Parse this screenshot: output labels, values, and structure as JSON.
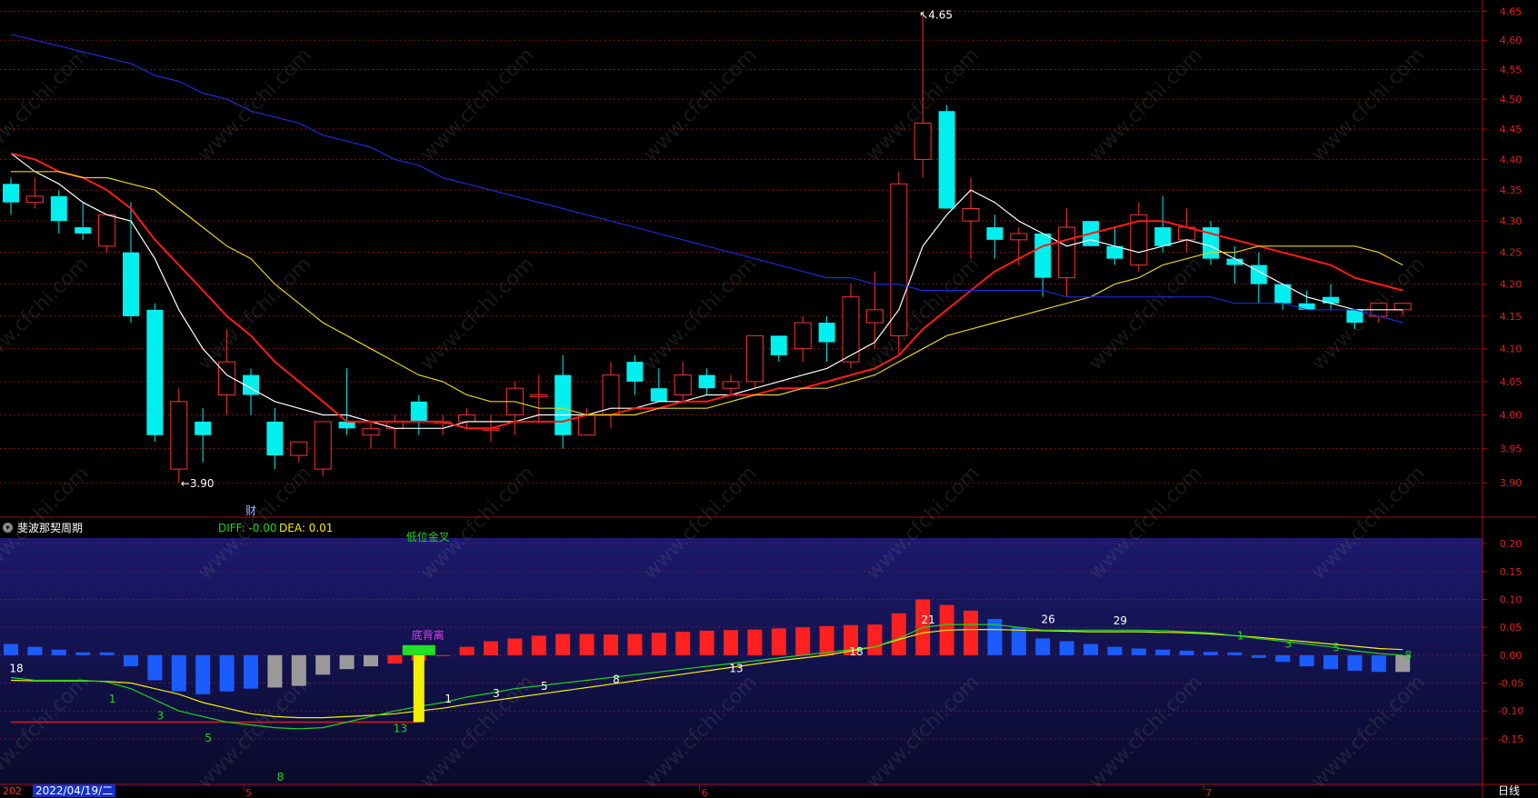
{
  "chart_data": [
    {
      "type": "candlestick",
      "scale": "log",
      "y_ticks": [
        "4.65",
        "4.60",
        "4.55",
        "4.50",
        "4.45",
        "4.40",
        "4.35",
        "4.30",
        "4.25",
        "4.20",
        "4.15",
        "4.10",
        "4.05",
        "4.00",
        "3.95",
        "3.90"
      ],
      "ylim": [
        3.87,
        4.66
      ],
      "ohlc": [
        [
          4.36,
          4.37,
          4.31,
          4.33
        ],
        [
          4.33,
          4.37,
          4.32,
          4.34
        ],
        [
          4.34,
          4.35,
          4.28,
          4.3
        ],
        [
          4.29,
          4.33,
          4.27,
          4.28
        ],
        [
          4.26,
          4.31,
          4.25,
          4.31
        ],
        [
          4.25,
          4.33,
          4.14,
          4.15
        ],
        [
          4.16,
          4.17,
          3.96,
          3.97
        ],
        [
          3.92,
          4.04,
          3.9,
          4.02
        ],
        [
          3.99,
          4.01,
          3.93,
          3.97
        ],
        [
          4.03,
          4.13,
          4.0,
          4.08
        ],
        [
          4.06,
          4.07,
          4.0,
          4.03
        ],
        [
          3.99,
          4.01,
          3.92,
          3.94
        ],
        [
          3.94,
          3.96,
          3.93,
          3.96
        ],
        [
          3.92,
          3.99,
          3.91,
          3.99
        ],
        [
          3.99,
          4.07,
          3.97,
          3.98
        ],
        [
          3.97,
          3.99,
          3.95,
          3.98
        ],
        [
          3.98,
          4.0,
          3.95,
          3.99
        ],
        [
          4.02,
          4.03,
          3.97,
          3.99
        ],
        [
          3.99,
          4.0,
          3.97,
          3.99
        ],
        [
          3.99,
          4.01,
          3.98,
          4.0
        ],
        [
          3.98,
          4.0,
          3.96,
          3.98
        ],
        [
          4.0,
          4.05,
          3.97,
          4.04
        ],
        [
          4.03,
          4.06,
          3.99,
          4.03
        ],
        [
          4.06,
          4.09,
          3.95,
          3.97
        ],
        [
          3.97,
          4.01,
          3.97,
          4.0
        ],
        [
          4.0,
          4.08,
          3.98,
          4.06
        ],
        [
          4.08,
          4.09,
          4.03,
          4.05
        ],
        [
          4.04,
          4.07,
          4.02,
          4.02
        ],
        [
          4.03,
          4.08,
          4.02,
          4.06
        ],
        [
          4.06,
          4.07,
          4.03,
          4.04
        ],
        [
          4.04,
          4.06,
          4.03,
          4.05
        ],
        [
          4.05,
          4.12,
          4.04,
          4.12
        ],
        [
          4.12,
          4.12,
          4.08,
          4.09
        ],
        [
          4.1,
          4.15,
          4.08,
          4.14
        ],
        [
          4.14,
          4.15,
          4.08,
          4.11
        ],
        [
          4.08,
          4.2,
          4.07,
          4.18
        ],
        [
          4.14,
          4.22,
          4.1,
          4.16
        ],
        [
          4.12,
          4.38,
          4.09,
          4.36
        ],
        [
          4.4,
          4.65,
          4.37,
          4.46
        ],
        [
          4.48,
          4.49,
          4.32,
          4.32
        ],
        [
          4.3,
          4.37,
          4.24,
          4.32
        ],
        [
          4.29,
          4.31,
          4.24,
          4.27
        ],
        [
          4.27,
          4.29,
          4.23,
          4.28
        ],
        [
          4.28,
          4.28,
          4.18,
          4.21
        ],
        [
          4.21,
          4.32,
          4.18,
          4.29
        ],
        [
          4.3,
          4.3,
          4.26,
          4.26
        ],
        [
          4.26,
          4.29,
          4.23,
          4.24
        ],
        [
          4.23,
          4.33,
          4.22,
          4.31
        ],
        [
          4.29,
          4.34,
          4.25,
          4.26
        ],
        [
          4.27,
          4.32,
          4.25,
          4.29
        ],
        [
          4.29,
          4.3,
          4.23,
          4.24
        ],
        [
          4.24,
          4.26,
          4.2,
          4.23
        ],
        [
          4.23,
          4.25,
          4.17,
          4.2
        ],
        [
          4.2,
          4.2,
          4.16,
          4.17
        ],
        [
          4.17,
          4.19,
          4.16,
          4.16
        ],
        [
          4.18,
          4.2,
          4.16,
          4.17
        ],
        [
          4.16,
          4.16,
          4.13,
          4.14
        ],
        [
          4.15,
          4.17,
          4.14,
          4.17
        ],
        [
          4.16,
          4.17,
          4.15,
          4.17
        ]
      ],
      "ma": [
        {
          "color": "#ffffff",
          "values": [
            4.41,
            4.38,
            4.36,
            4.33,
            4.31,
            4.3,
            4.24,
            4.16,
            4.1,
            4.06,
            4.04,
            4.02,
            4.01,
            4.0,
            4.0,
            3.99,
            3.98,
            3.98,
            3.98,
            3.99,
            3.99,
            3.99,
            4.0,
            4.0,
            4.0,
            4.01,
            4.01,
            4.02,
            4.02,
            4.03,
            4.03,
            4.04,
            4.05,
            4.06,
            4.07,
            4.09,
            4.11,
            4.16,
            4.26,
            4.31,
            4.35,
            4.33,
            4.3,
            4.28,
            4.26,
            4.27,
            4.26,
            4.25,
            4.26,
            4.27,
            4.26,
            4.24,
            4.22,
            4.2,
            4.18,
            4.17,
            4.16,
            4.16,
            4.16
          ]
        },
        {
          "color": "#ff1a1a",
          "values": [
            4.41,
            4.4,
            4.38,
            4.37,
            4.35,
            4.32,
            4.27,
            4.23,
            4.19,
            4.15,
            4.12,
            4.08,
            4.05,
            4.02,
            3.99,
            3.99,
            3.99,
            3.99,
            3.99,
            3.98,
            3.98,
            3.99,
            3.99,
            3.99,
            4.0,
            4.0,
            4.01,
            4.01,
            4.02,
            4.02,
            4.03,
            4.03,
            4.04,
            4.04,
            4.05,
            4.06,
            4.07,
            4.09,
            4.13,
            4.16,
            4.19,
            4.22,
            4.24,
            4.26,
            4.27,
            4.28,
            4.29,
            4.3,
            4.3,
            4.29,
            4.28,
            4.27,
            4.26,
            4.25,
            4.24,
            4.23,
            4.21,
            4.2,
            4.19
          ]
        },
        {
          "color": "#e6d41a",
          "values": [
            4.38,
            4.38,
            4.38,
            4.37,
            4.37,
            4.36,
            4.35,
            4.32,
            4.29,
            4.26,
            4.24,
            4.2,
            4.17,
            4.14,
            4.12,
            4.1,
            4.08,
            4.06,
            4.05,
            4.03,
            4.02,
            4.02,
            4.01,
            4.01,
            4.0,
            4.0,
            4.0,
            4.01,
            4.01,
            4.01,
            4.02,
            4.03,
            4.03,
            4.04,
            4.04,
            4.05,
            4.06,
            4.08,
            4.1,
            4.12,
            4.13,
            4.14,
            4.15,
            4.16,
            4.17,
            4.18,
            4.2,
            4.21,
            4.23,
            4.24,
            4.25,
            4.25,
            4.26,
            4.26,
            4.26,
            4.26,
            4.26,
            4.25,
            4.23
          ]
        },
        {
          "color": "#1c2cd6",
          "values": [
            4.61,
            4.6,
            4.59,
            4.58,
            4.57,
            4.56,
            4.54,
            4.53,
            4.51,
            4.5,
            4.48,
            4.47,
            4.46,
            4.44,
            4.43,
            4.42,
            4.4,
            4.39,
            4.37,
            4.36,
            4.35,
            4.34,
            4.33,
            4.32,
            4.31,
            4.3,
            4.29,
            4.28,
            4.27,
            4.26,
            4.25,
            4.24,
            4.23,
            4.22,
            4.21,
            4.21,
            4.2,
            4.2,
            4.19,
            4.19,
            4.19,
            4.19,
            4.19,
            4.19,
            4.18,
            4.18,
            4.18,
            4.18,
            4.18,
            4.18,
            4.18,
            4.17,
            4.17,
            4.17,
            4.16,
            4.16,
            4.16,
            4.15,
            4.14
          ]
        }
      ],
      "annotations": [
        {
          "text": "4.65",
          "bar": 38,
          "at": "high"
        },
        {
          "text": "3.90",
          "bar": 7,
          "at": "low"
        },
        {
          "text": "财",
          "bar": 10,
          "at": "below"
        }
      ]
    },
    {
      "type": "macd",
      "title": "斐波那契周期",
      "diff_label": "DIFF: -0.00",
      "dea_label": "DEA: 0.01",
      "y_ticks": [
        "0.20",
        "0.15",
        "0.10",
        "0.05",
        "0.00",
        "-0.05",
        "-0.10",
        "-0.15"
      ],
      "ylim": [
        -0.23,
        0.21
      ],
      "macd": [
        0.02,
        0.015,
        0.01,
        0.005,
        0.005,
        -0.02,
        -0.045,
        -0.065,
        -0.07,
        -0.065,
        -0.06,
        -0.058,
        -0.055,
        -0.035,
        -0.025,
        -0.02,
        -0.015,
        -0.01,
        0.0,
        0.015,
        0.025,
        0.03,
        0.035,
        0.038,
        0.038,
        0.037,
        0.038,
        0.04,
        0.042,
        0.044,
        0.045,
        0.046,
        0.048,
        0.05,
        0.052,
        0.054,
        0.055,
        0.075,
        0.1,
        0.09,
        0.08,
        0.065,
        0.05,
        0.03,
        0.025,
        0.02,
        0.015,
        0.012,
        0.01,
        0.008,
        0.006,
        0.005,
        -0.005,
        -0.012,
        -0.02,
        -0.025,
        -0.028,
        -0.03,
        -0.03
      ],
      "macd_colors": [
        "b",
        "b",
        "b",
        "b",
        "b",
        "b",
        "b",
        "b",
        "b",
        "b",
        "b",
        "g",
        "g",
        "g",
        "g",
        "g",
        "r",
        "r",
        "r",
        "r",
        "r",
        "r",
        "r",
        "r",
        "r",
        "r",
        "r",
        "r",
        "r",
        "r",
        "r",
        "r",
        "r",
        "r",
        "r",
        "r",
        "r",
        "r",
        "r",
        "r",
        "r",
        "b",
        "b",
        "b",
        "b",
        "b",
        "b",
        "b",
        "b",
        "b",
        "b",
        "b",
        "b",
        "b",
        "b",
        "b",
        "b",
        "b",
        "g"
      ],
      "diff_line": [
        -0.04,
        -0.045,
        -0.045,
        -0.045,
        -0.048,
        -0.06,
        -0.08,
        -0.1,
        -0.11,
        -0.12,
        -0.125,
        -0.13,
        -0.132,
        -0.13,
        -0.12,
        -0.11,
        -0.1,
        -0.092,
        -0.085,
        -0.075,
        -0.068,
        -0.06,
        -0.055,
        -0.05,
        -0.045,
        -0.04,
        -0.035,
        -0.03,
        -0.025,
        -0.02,
        -0.015,
        -0.01,
        -0.005,
        0.0,
        0.005,
        0.01,
        0.015,
        0.03,
        0.05,
        0.055,
        0.055,
        0.055,
        0.05,
        0.045,
        0.045,
        0.045,
        0.045,
        0.045,
        0.044,
        0.042,
        0.04,
        0.035,
        0.03,
        0.025,
        0.02,
        0.015,
        0.008,
        0.003,
        0.0
      ],
      "dea_line": [
        -0.045,
        -0.046,
        -0.046,
        -0.046,
        -0.047,
        -0.05,
        -0.06,
        -0.07,
        -0.085,
        -0.095,
        -0.105,
        -0.11,
        -0.112,
        -0.112,
        -0.11,
        -0.108,
        -0.105,
        -0.1,
        -0.095,
        -0.088,
        -0.082,
        -0.076,
        -0.07,
        -0.064,
        -0.058,
        -0.052,
        -0.046,
        -0.04,
        -0.034,
        -0.028,
        -0.022,
        -0.016,
        -0.01,
        -0.005,
        0.0,
        0.008,
        0.015,
        0.028,
        0.04,
        0.045,
        0.046,
        0.046,
        0.045,
        0.044,
        0.043,
        0.042,
        0.042,
        0.042,
        0.041,
        0.04,
        0.038,
        0.035,
        0.032,
        0.028,
        0.024,
        0.02,
        0.016,
        0.012,
        0.01
      ],
      "signal_line_value": -0.12,
      "labels": [
        {
          "text": "18",
          "bar": 0,
          "value": -0.03,
          "color": "#ffffff"
        },
        {
          "text": "1",
          "bar": 4,
          "value": -0.085,
          "color": "#1fd41f"
        },
        {
          "text": "3",
          "bar": 6,
          "value": -0.115,
          "color": "#1fd41f"
        },
        {
          "text": "5",
          "bar": 8,
          "value": -0.155,
          "color": "#1fd41f"
        },
        {
          "text": "8",
          "bar": 11,
          "value": -0.225,
          "color": "#1fd41f"
        },
        {
          "text": "13",
          "bar": 16,
          "value": -0.138,
          "color": "#1fd41f"
        },
        {
          "text": "1",
          "bar": 18,
          "value": -0.085,
          "color": "#ffffff"
        },
        {
          "text": "3",
          "bar": 20,
          "value": -0.075,
          "color": "#ffffff"
        },
        {
          "text": "5",
          "bar": 22,
          "value": -0.062,
          "color": "#ffffff"
        },
        {
          "text": "8",
          "bar": 25,
          "value": -0.05,
          "color": "#ffffff"
        },
        {
          "text": "13",
          "bar": 30,
          "value": -0.03,
          "color": "#ffffff"
        },
        {
          "text": "18",
          "bar": 35,
          "value": 0.0,
          "color": "#ffffff"
        },
        {
          "text": "21",
          "bar": 38,
          "value": 0.057,
          "color": "#ffffff"
        },
        {
          "text": "26",
          "bar": 43,
          "value": 0.058,
          "color": "#ffffff"
        },
        {
          "text": "29",
          "bar": 46,
          "value": 0.055,
          "color": "#ffffff"
        },
        {
          "text": "1",
          "bar": 51,
          "value": 0.028,
          "color": "#1fd41f"
        },
        {
          "text": "3",
          "bar": 53,
          "value": 0.014,
          "color": "#1fd41f"
        },
        {
          "text": "5",
          "bar": 55,
          "value": 0.007,
          "color": "#1fd41f"
        },
        {
          "text": "8",
          "bar": 58,
          "value": -0.007,
          "color": "#1fd41f"
        }
      ],
      "signals": [
        {
          "text": "低位金叉",
          "bar": 17,
          "value": 0.2,
          "color": "#1fd41f"
        },
        {
          "text": "底背离",
          "bar": 17,
          "value": 0.024,
          "color": "#e23ce6"
        }
      ]
    }
  ],
  "x_axis": {
    "prefix": "202",
    "selected_date": "2022/04/19/二",
    "months": [
      {
        "label": "5",
        "bar": 10
      },
      {
        "label": "6",
        "bar": 29
      },
      {
        "label": "7",
        "bar": 50
      }
    ]
  },
  "indicator": {
    "title": "斐波那契周期",
    "diff": "DIFF: -0.00",
    "dea": "DEA: 0.01"
  },
  "period_label": "日线",
  "watermark": "www.cfchi.com",
  "colors": {
    "up": "#ff3030",
    "down": "#00f0f0",
    "axis": "#a01010",
    "grid": "#8a1010"
  }
}
